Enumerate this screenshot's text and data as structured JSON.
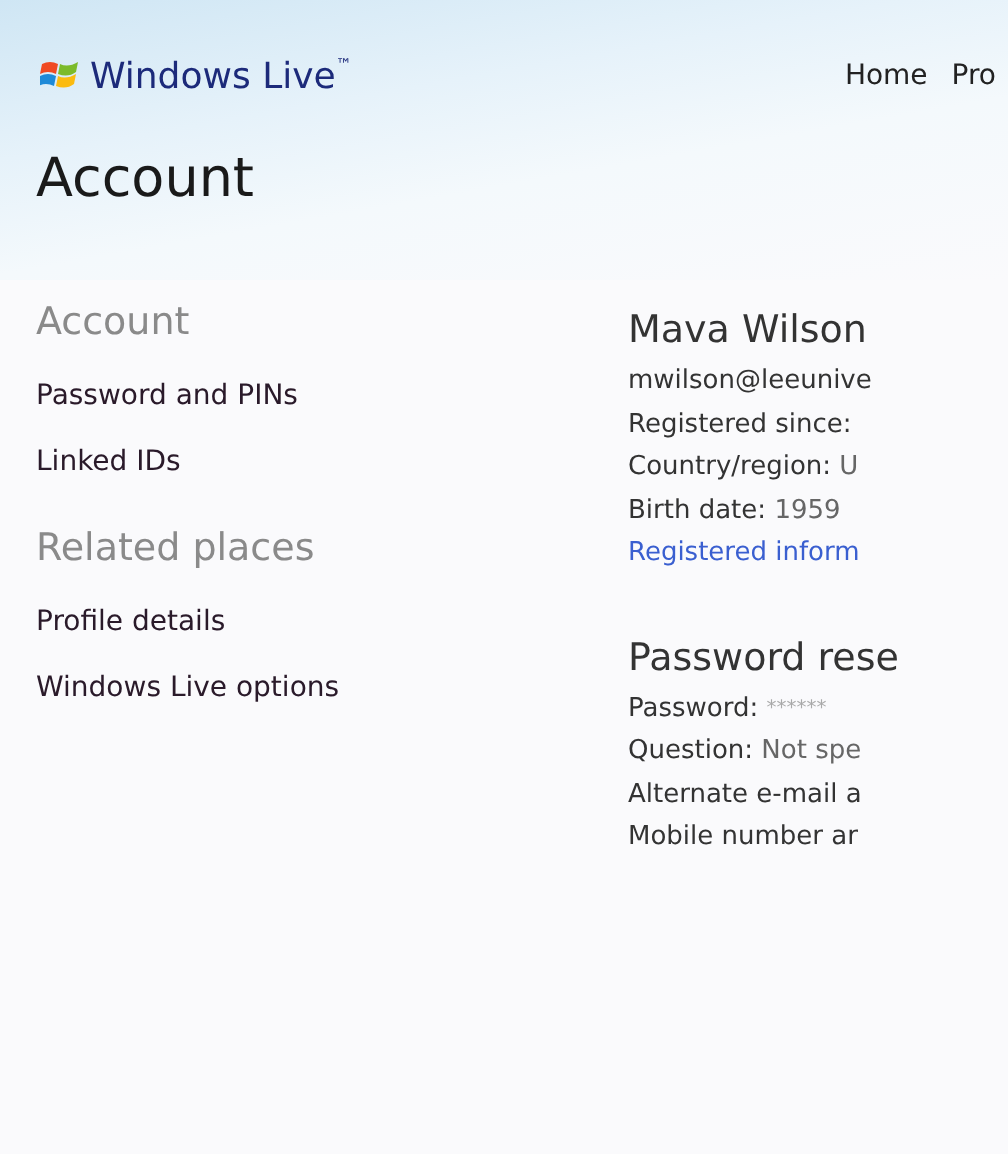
{
  "header": {
    "brand": "Windows Live",
    "trademark": "™",
    "nav": [
      {
        "label": "Home"
      },
      {
        "label": "Pro"
      }
    ],
    "page_title": "Account"
  },
  "sidebar": {
    "sections": [
      {
        "heading": "Account",
        "links": [
          "Password and PINs",
          "Linked IDs"
        ]
      },
      {
        "heading": "Related places",
        "links": [
          "Profile details",
          "Windows Live options"
        ]
      }
    ]
  },
  "profile": {
    "name": "Mava Wilson",
    "email": "mwilson@leeunive",
    "fields": [
      {
        "label": "Registered since:"
      },
      {
        "label": "Country/region:",
        "value": "U"
      },
      {
        "label": "Birth date:",
        "value": "1959"
      }
    ],
    "link": "Registered inform"
  },
  "password_reset": {
    "heading": "Password rese",
    "fields": [
      {
        "label": "Password:",
        "value": "******",
        "kind": "masked"
      },
      {
        "label": "Question:",
        "value": "Not spe",
        "kind": "plain"
      },
      {
        "label": "Alternate e-mail a"
      },
      {
        "label": "Mobile number ar"
      }
    ]
  }
}
